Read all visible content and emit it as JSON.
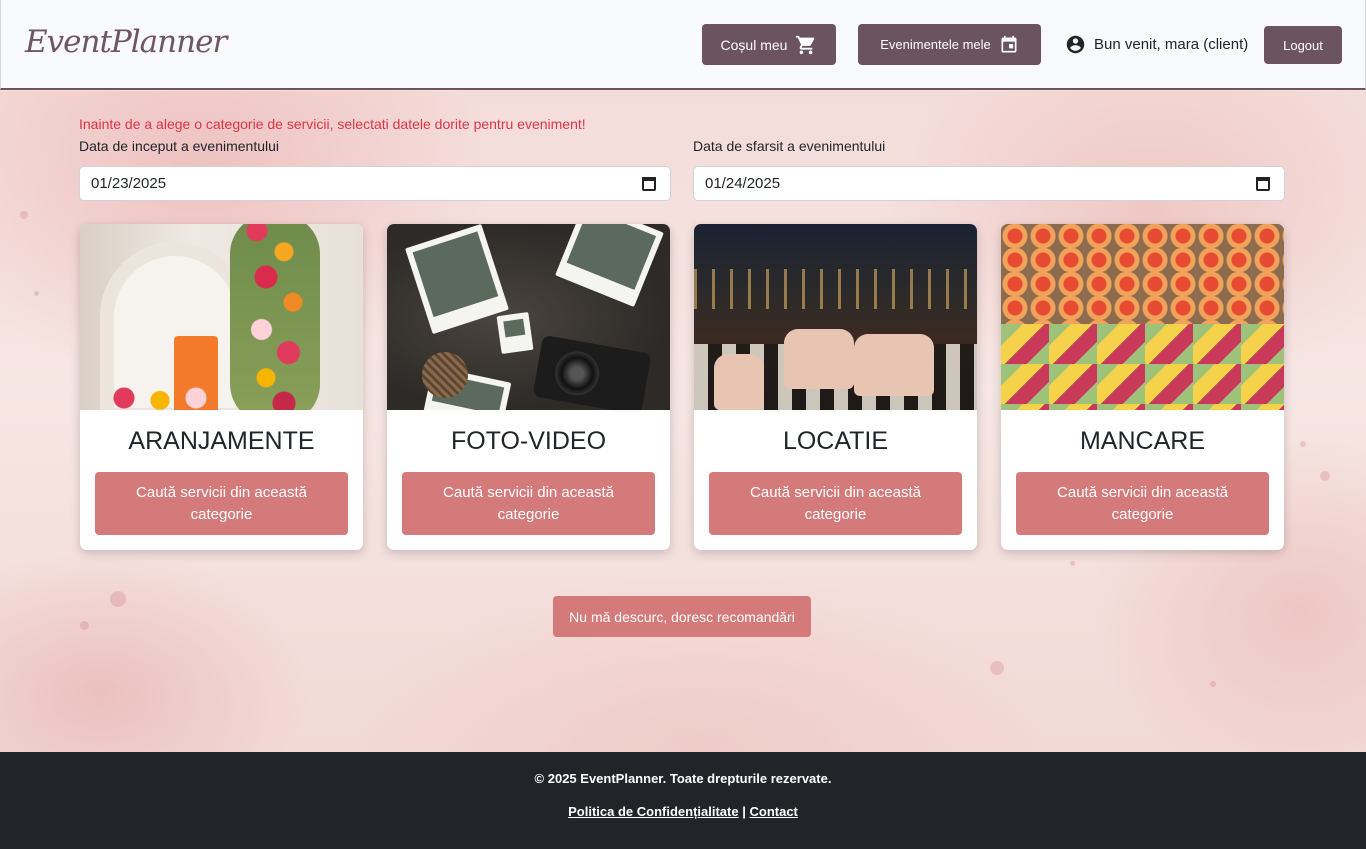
{
  "header": {
    "logo": "EventPlanner",
    "cart_label": "Coșul meu",
    "events_label": "Evenimentele mele",
    "welcome_text": "Bun venit, mara (client)",
    "logout_label": "Logout"
  },
  "main": {
    "warning": "Inainte de a alege o categorie de servicii, selectati datele dorite pentru eveniment!",
    "start_label": "Data de inceput a evenimentului",
    "start_value": "01/23/2025",
    "end_label": "Data de sfarsit a evenimentului",
    "end_value": "01/24/2025",
    "categories": [
      {
        "title": "ARANJAMENTE",
        "button": "Caută servicii din această categorie"
      },
      {
        "title": "FOTO-VIDEO",
        "button": "Caută servicii din această categorie"
      },
      {
        "title": "LOCATIE",
        "button": "Caută servicii din această categorie"
      },
      {
        "title": "MANCARE",
        "button": "Caută servicii din această categorie"
      }
    ],
    "recommend_label": "Nu mă descurc, doresc recomandări"
  },
  "footer": {
    "copyright": "© 2025 EventPlanner. Toate drepturile rezervate.",
    "privacy_link": "Politica de Confidențialitate",
    "separator": "|",
    "contact_link": "Contact"
  },
  "colors": {
    "header_button": "#6b5360",
    "action_button": "#d47a7a",
    "warning": "#dc3545",
    "footer_bg": "#212529"
  },
  "icons": {
    "cart": "cart-icon",
    "events": "calendar-icon",
    "user": "account-circle-icon"
  }
}
